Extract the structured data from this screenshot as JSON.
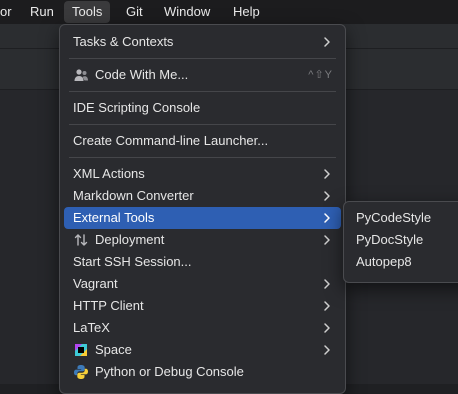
{
  "menubar": {
    "items": [
      {
        "label": "or"
      },
      {
        "label": "Run"
      },
      {
        "label": "Tools"
      },
      {
        "label": "Git"
      },
      {
        "label": "Window"
      },
      {
        "label": "Help"
      }
    ],
    "active": "Tools"
  },
  "tools_menu": {
    "items": [
      {
        "label": "Tasks & Contexts",
        "submenu": true
      },
      {
        "label": "Code With Me...",
        "icon": "people-icon",
        "shortcut": "^⇧Y"
      },
      {
        "label": "IDE Scripting Console"
      },
      {
        "label": "Create Command-line Launcher..."
      },
      {
        "label": "XML Actions",
        "submenu": true
      },
      {
        "label": "Markdown Converter",
        "submenu": true
      },
      {
        "label": "External Tools",
        "submenu": true,
        "selected": true
      },
      {
        "label": "Deployment",
        "icon": "deployment-arrows-icon",
        "submenu": true
      },
      {
        "label": "Start SSH Session..."
      },
      {
        "label": "Vagrant",
        "submenu": true
      },
      {
        "label": "HTTP Client",
        "submenu": true
      },
      {
        "label": "LaTeX",
        "submenu": true
      },
      {
        "label": "Space",
        "icon": "space-logo-icon",
        "submenu": true
      },
      {
        "label": "Python or Debug Console",
        "icon": "python-logo-icon"
      }
    ]
  },
  "external_tools_menu": {
    "items": [
      {
        "label": "PyCodeStyle"
      },
      {
        "label": "PyDocStyle"
      },
      {
        "label": "Autopep8"
      }
    ]
  },
  "colors": {
    "selection": "#2e5fb3",
    "menu_background": "#2a2b2f",
    "menubar_background": "#1c1c1e"
  }
}
